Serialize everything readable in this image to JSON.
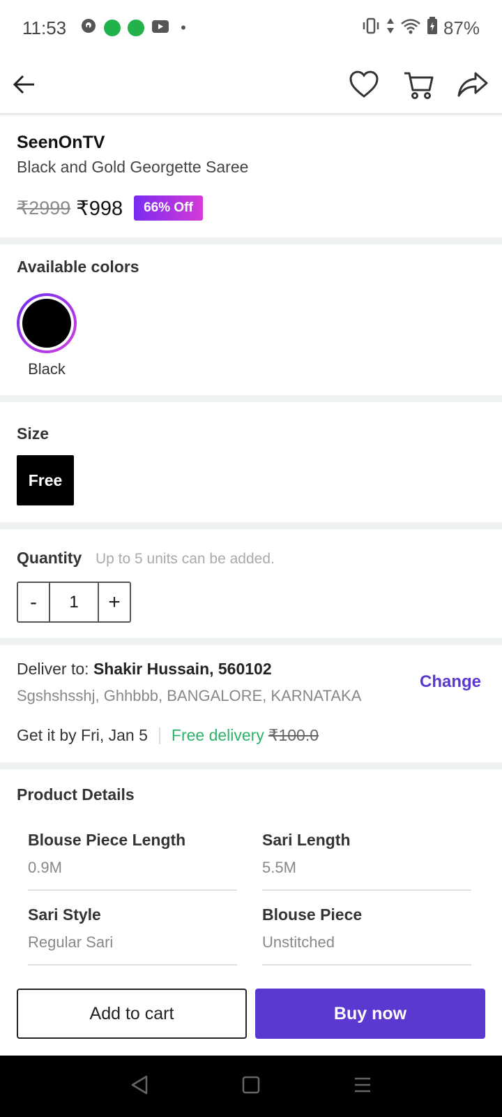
{
  "status_bar": {
    "time": "11:53",
    "battery": "87%"
  },
  "product": {
    "brand": "SeenOnTV",
    "name": "Black and Gold Georgette Saree",
    "original_price": "₹2999",
    "price": "₹998",
    "discount": "66% Off"
  },
  "colors": {
    "title": "Available colors",
    "selected": "Black",
    "swatch_hex": "#000000"
  },
  "size": {
    "title": "Size",
    "selected": "Free"
  },
  "quantity": {
    "title": "Quantity",
    "note": "Up to 5 units can be added.",
    "minus": "-",
    "value": "1",
    "plus": "+"
  },
  "delivery": {
    "prefix": "Deliver to:",
    "recipient": "Shakir Hussain, 560102",
    "address": "Sgshshsshj, Ghhbbb, BANGALORE, KARNATAKA",
    "change_label": "Change",
    "eta": "Get it by Fri, Jan 5",
    "free_label": "Free delivery",
    "fee": "₹100.0"
  },
  "details": {
    "title": "Product Details",
    "items": [
      {
        "label": "Blouse Piece Length",
        "value": "0.9M"
      },
      {
        "label": "Sari Length",
        "value": "5.5M"
      },
      {
        "label": "Sari Style",
        "value": "Regular Sari"
      },
      {
        "label": "Blouse Piece",
        "value": "Unstitched"
      }
    ]
  },
  "actions": {
    "add_to_cart": "Add to cart",
    "buy_now": "Buy now"
  },
  "theme": {
    "accent": "#5b38cf",
    "free_green": "#2fb36a"
  }
}
